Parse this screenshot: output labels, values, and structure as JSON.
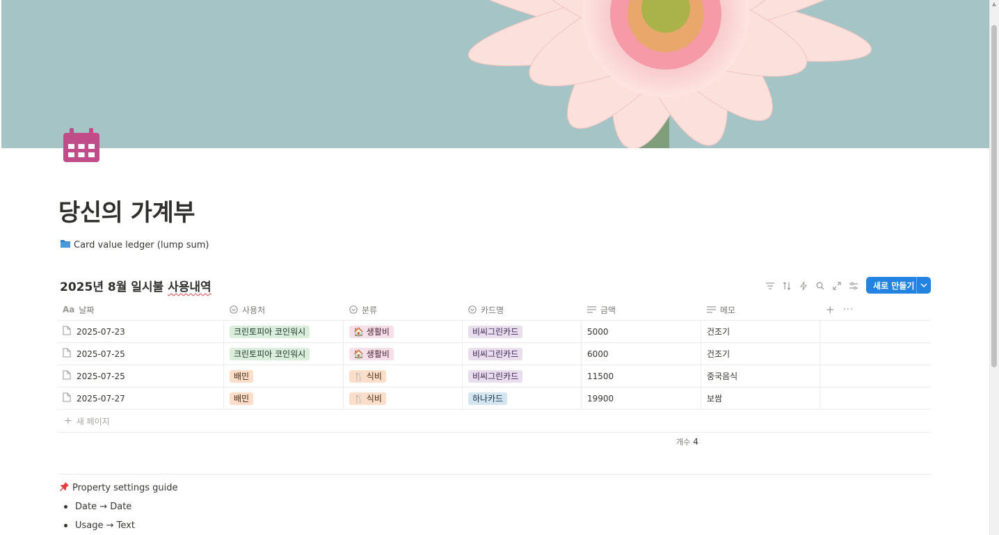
{
  "page": {
    "title": "당신의 가계부",
    "icon": "calendar-icon",
    "icon_color": "#c14c8a",
    "linked_page": {
      "icon": "folder-icon",
      "label": "Card value ledger (lump sum)"
    }
  },
  "database": {
    "title_prefix": "2025년 8월 일시불 ",
    "title_underlined": "사용내역",
    "toolbar": [
      "filter-icon",
      "sort-icon",
      "lightning-icon",
      "search-icon",
      "expand-icon",
      "settings-icon"
    ],
    "new_button_label": "새로 만들기",
    "accent_color": "#2383e2",
    "columns": [
      {
        "icon": "Aa",
        "label": "날짜"
      },
      {
        "icon": "select-icon",
        "label": "사용처"
      },
      {
        "icon": "select-icon",
        "label": "분류"
      },
      {
        "icon": "select-icon",
        "label": "카드명"
      },
      {
        "icon": "text-icon",
        "label": "금액"
      },
      {
        "icon": "text-icon",
        "label": "메모"
      }
    ],
    "rows": [
      {
        "date": "2025-07-23",
        "place": "크린토피아 코인워시",
        "category_icon": "🏠",
        "category": "생활비",
        "card": "비씨그린카드",
        "amount": "5000",
        "memo": "건조기"
      },
      {
        "date": "2025-07-25",
        "place": "크린토피아 코인워시",
        "category_icon": "🏠",
        "category": "생활비",
        "card": "비씨그린카드",
        "amount": "6000",
        "memo": "건조기"
      },
      {
        "date": "2025-07-25",
        "place": "배민",
        "category_icon": "🍴",
        "category": "식비",
        "card": "비씨그린카드",
        "amount": "11500",
        "memo": "중국음식"
      },
      {
        "date": "2025-07-27",
        "place": "배민",
        "category_icon": "🍴",
        "category": "식비",
        "card": "하나카드",
        "amount": "19900",
        "memo": "보쌈"
      }
    ],
    "new_page_label": "새 페이지",
    "count_label": "개수",
    "count_value": "4"
  },
  "guide": {
    "icon": "pin-icon",
    "title": "Property settings guide",
    "items": [
      "Date → Date",
      "Usage → Text"
    ]
  }
}
